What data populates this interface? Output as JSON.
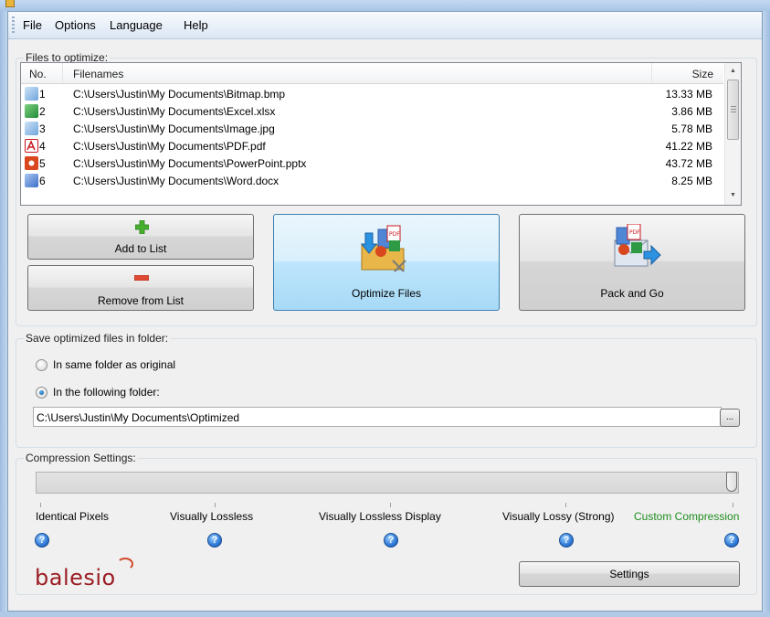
{
  "menubar": {
    "items": [
      "File",
      "Options",
      "Language",
      "Help"
    ]
  },
  "files_group": {
    "label": "Files to optimize:",
    "columns": {
      "no": "No.",
      "filename": "Filenames",
      "size": "Size"
    },
    "rows": [
      {
        "no": "1",
        "filename": "C:\\Users\\Justin\\My Documents\\Bitmap.bmp",
        "size": "13.33 MB",
        "icon": "image-file-icon",
        "color": "#6ea6dc"
      },
      {
        "no": "2",
        "filename": "C:\\Users\\Justin\\My Documents\\Excel.xlsx",
        "size": "3.86 MB",
        "icon": "excel-file-icon",
        "color": "#1f8a3a"
      },
      {
        "no": "3",
        "filename": "C:\\Users\\Justin\\My Documents\\Image.jpg",
        "size": "5.78 MB",
        "icon": "image-file-icon",
        "color": "#6ea6dc"
      },
      {
        "no": "4",
        "filename": "C:\\Users\\Justin\\My Documents\\PDF.pdf",
        "size": "41.22 MB",
        "icon": "pdf-file-icon",
        "color": "#c8171e"
      },
      {
        "no": "5",
        "filename": "C:\\Users\\Justin\\My Documents\\PowerPoint.pptx",
        "size": "43.72 MB",
        "icon": "powerpoint-file-icon",
        "color": "#d9471e"
      },
      {
        "no": "6",
        "filename": "C:\\Users\\Justin\\My Documents\\Word.docx",
        "size": "8.25 MB",
        "icon": "word-file-icon",
        "color": "#3c6fc8"
      }
    ],
    "add_label": "Add to List",
    "remove_label": "Remove from List",
    "optimize_label": "Optimize Files",
    "pack_label": "Pack and Go"
  },
  "save_group": {
    "label": "Save optimized files in folder:",
    "option_same": "In same folder as original",
    "option_following": "In the following folder:",
    "selected": "following",
    "folder_path": "C:\\Users\\Justin\\My Documents\\Optimized",
    "browse_label": "..."
  },
  "compression_group": {
    "label": "Compression Settings:",
    "levels": [
      "Identical Pixels",
      "Visually Lossless",
      "Visually Lossless Display",
      "Visually Lossy (Strong)",
      "Custom Compression"
    ],
    "selected_level": "Custom Compression",
    "slider_value": 1.0,
    "accent_color": "#1e8c1e",
    "help_glyph": "?",
    "settings_label": "Settings"
  },
  "brand": {
    "logo_text": "balesio"
  }
}
